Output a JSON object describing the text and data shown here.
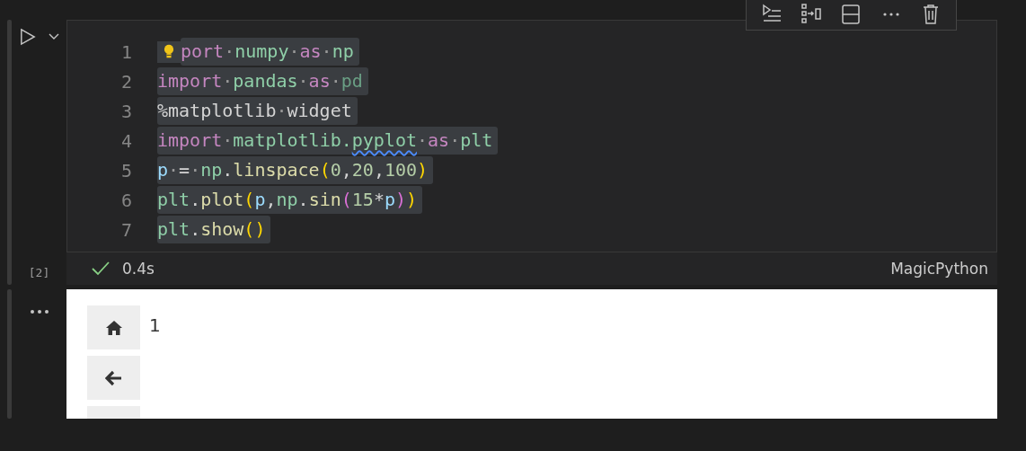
{
  "cell_toolbar": {
    "buttons": [
      {
        "kind": "run-below"
      },
      {
        "kind": "split"
      },
      {
        "kind": "layout"
      },
      {
        "kind": "more"
      },
      {
        "kind": "delete"
      }
    ]
  },
  "cell": {
    "execution_count": "[2]",
    "status": "0.4s",
    "language": "MagicPython",
    "lightbulb": true,
    "lines": [
      {
        "number": "1",
        "tokens": [
          {
            "kind": "kw",
            "text": "port"
          },
          {
            "kind": "ws",
            "text": "·"
          },
          {
            "kind": "mod",
            "text": "numpy"
          },
          {
            "kind": "ws",
            "text": "·"
          },
          {
            "kind": "kw",
            "text": "as"
          },
          {
            "kind": "ws",
            "text": "·"
          },
          {
            "kind": "mod",
            "text": "np"
          }
        ]
      },
      {
        "number": "2",
        "tokens": [
          {
            "kind": "kw",
            "text": "import"
          },
          {
            "kind": "ws",
            "text": "·"
          },
          {
            "kind": "mod",
            "text": "pandas"
          },
          {
            "kind": "ws",
            "text": "·"
          },
          {
            "kind": "kw",
            "text": "as"
          },
          {
            "kind": "ws",
            "text": "·"
          },
          {
            "kind": "dim",
            "text": "pd"
          }
        ]
      },
      {
        "number": "3",
        "tokens": [
          {
            "kind": "plain",
            "text": "%matplotlib"
          },
          {
            "kind": "ws",
            "text": "·"
          },
          {
            "kind": "plain",
            "text": "widget"
          }
        ]
      },
      {
        "number": "4",
        "tokens": [
          {
            "kind": "kw",
            "text": "import"
          },
          {
            "kind": "ws",
            "text": "·"
          },
          {
            "kind": "mod",
            "text": "matplotlib."
          },
          {
            "kind": "warn",
            "text": "pyplot"
          },
          {
            "kind": "ws",
            "text": "·"
          },
          {
            "kind": "kw",
            "text": "as"
          },
          {
            "kind": "ws",
            "text": "·"
          },
          {
            "kind": "mod",
            "text": "plt"
          }
        ]
      },
      {
        "number": "5",
        "tokens": [
          {
            "kind": "var",
            "text": "p"
          },
          {
            "kind": "ws",
            "text": "·"
          },
          {
            "kind": "plain",
            "text": "="
          },
          {
            "kind": "ws",
            "text": "·"
          },
          {
            "kind": "mod",
            "text": "np"
          },
          {
            "kind": "plain",
            "text": "."
          },
          {
            "kind": "fn",
            "text": "linspace"
          },
          {
            "kind": "paren",
            "text": "("
          },
          {
            "kind": "num",
            "text": "0"
          },
          {
            "kind": "plain",
            "text": ","
          },
          {
            "kind": "num",
            "text": "20"
          },
          {
            "kind": "plain",
            "text": ","
          },
          {
            "kind": "num",
            "text": "100"
          },
          {
            "kind": "paren",
            "text": ")"
          }
        ]
      },
      {
        "number": "6",
        "tokens": [
          {
            "kind": "mod",
            "text": "plt"
          },
          {
            "kind": "plain",
            "text": "."
          },
          {
            "kind": "fn",
            "text": "plot"
          },
          {
            "kind": "paren",
            "text": "("
          },
          {
            "kind": "var",
            "text": "p"
          },
          {
            "kind": "plain",
            "text": ","
          },
          {
            "kind": "mod",
            "text": "np"
          },
          {
            "kind": "plain",
            "text": "."
          },
          {
            "kind": "fn",
            "text": "sin"
          },
          {
            "kind": "paren2",
            "text": "("
          },
          {
            "kind": "num",
            "text": "15"
          },
          {
            "kind": "plain",
            "text": "*"
          },
          {
            "kind": "var",
            "text": "p"
          },
          {
            "kind": "paren2",
            "text": ")"
          },
          {
            "kind": "paren",
            "text": ")"
          }
        ]
      },
      {
        "number": "7",
        "tokens": [
          {
            "kind": "mod",
            "text": "plt"
          },
          {
            "kind": "plain",
            "text": "."
          },
          {
            "kind": "fn",
            "text": "show"
          },
          {
            "kind": "paren",
            "text": "()"
          }
        ]
      }
    ]
  },
  "output": {
    "toolbar": [
      {
        "kind": "home"
      },
      {
        "kind": "back"
      },
      {
        "kind": "partial"
      }
    ],
    "label": "1"
  }
}
